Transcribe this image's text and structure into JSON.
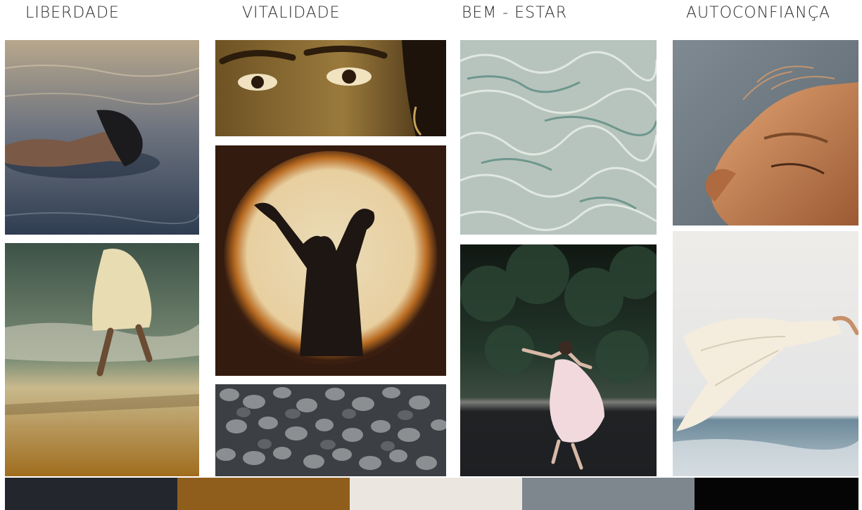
{
  "headings": {
    "col1": "LIBERDADE",
    "col2": "VITALIDADE",
    "col3": "BEM - ESTAR",
    "col4": "AUTOCONFIANÇA"
  },
  "palette": [
    "#23272d",
    "#8f5e1d",
    "#ebe7e0",
    "#7e878d",
    "#050505"
  ],
  "photos": [
    "woman-floating-in-water",
    "woman-running-on-beach",
    "woman-eyes-closeup",
    "dancer-silhouette-in-light",
    "pebbles",
    "water-surface-caustics",
    "woman-dancing-on-road",
    "sunlit-face-closeup",
    "flowing-fabric-by-sea"
  ]
}
